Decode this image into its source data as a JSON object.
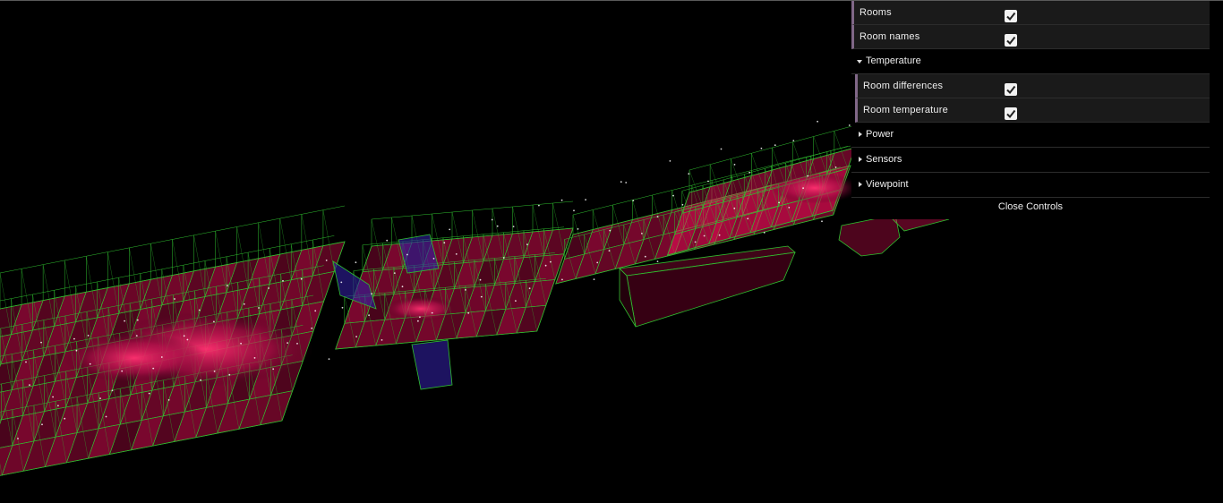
{
  "controls": {
    "rooms_label": "Rooms",
    "room_names_label": "Room names",
    "temperature_folder": "Temperature",
    "room_differences_label": "Room differences",
    "room_temperature_label": "Room temperature",
    "power_folder": "Power",
    "sensors_folder": "Sensors",
    "viewpoint_folder": "Viewpoint",
    "close_label": "Close Controls",
    "rooms_checked": true,
    "room_names_checked": true,
    "room_differences_checked": true,
    "room_temperature_checked": true
  },
  "colors": {
    "wireframe": "#2fbf2f",
    "warm_room": "#ff1060",
    "cool_room": "#3020a0",
    "panel_bg": "#1a1a1a",
    "bool_accent": "#806787"
  }
}
